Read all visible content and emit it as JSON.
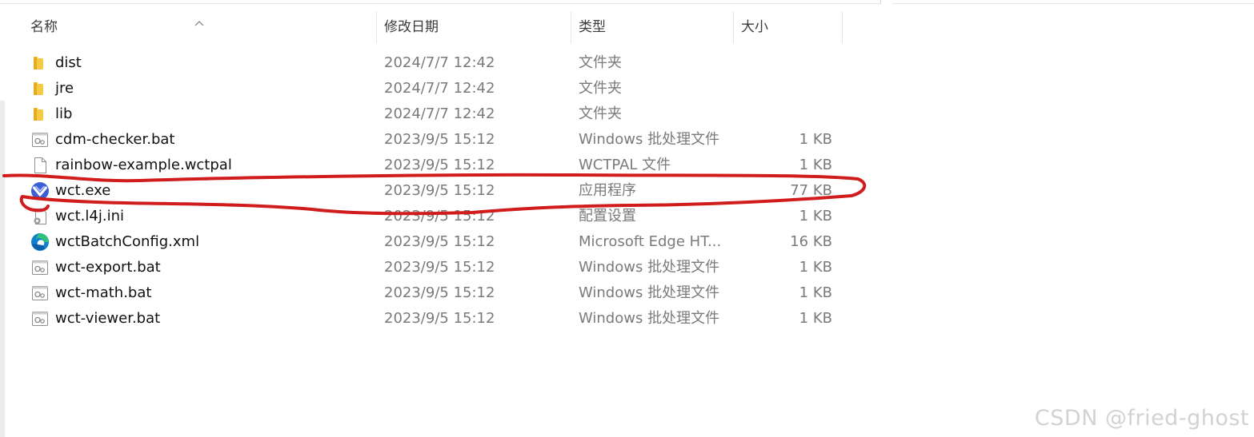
{
  "columns": {
    "name": "名称",
    "date": "修改日期",
    "type": "类型",
    "size": "大小"
  },
  "files": [
    {
      "icon": "folder-icon",
      "name": "dist",
      "date": "2024/7/7 12:42",
      "type": "文件夹",
      "size": ""
    },
    {
      "icon": "folder-icon",
      "name": "jre",
      "date": "2024/7/7 12:42",
      "type": "文件夹",
      "size": ""
    },
    {
      "icon": "folder-icon",
      "name": "lib",
      "date": "2024/7/7 12:42",
      "type": "文件夹",
      "size": ""
    },
    {
      "icon": "batch-file-icon",
      "name": "cdm-checker.bat",
      "date": "2023/9/5 15:12",
      "type": "Windows 批处理文件",
      "size": "1 KB"
    },
    {
      "icon": "blank-file-icon",
      "name": "rainbow-example.wctpal",
      "date": "2023/9/5 15:12",
      "type": "WCTPAL 文件",
      "size": "1 KB"
    },
    {
      "icon": "wct-app-icon",
      "name": "wct.exe",
      "date": "2023/9/5 15:12",
      "type": "应用程序",
      "size": "77 KB"
    },
    {
      "icon": "config-file-icon",
      "name": "wct.l4j.ini",
      "date": "2023/9/5 15:12",
      "type": "配置设置",
      "size": "1 KB"
    },
    {
      "icon": "edge-icon",
      "name": "wctBatchConfig.xml",
      "date": "2023/9/5 15:12",
      "type": "Microsoft Edge HT...",
      "size": "16 KB"
    },
    {
      "icon": "batch-file-icon",
      "name": "wct-export.bat",
      "date": "2023/9/5 15:12",
      "type": "Windows 批处理文件",
      "size": "1 KB"
    },
    {
      "icon": "batch-file-icon",
      "name": "wct-math.bat",
      "date": "2023/9/5 15:12",
      "type": "Windows 批处理文件",
      "size": "1 KB"
    },
    {
      "icon": "batch-file-icon",
      "name": "wct-viewer.bat",
      "date": "2023/9/5 15:12",
      "type": "Windows 批处理文件",
      "size": "1 KB"
    }
  ],
  "highlighted_row": 5,
  "annotation_color": "#d01c1c",
  "watermark": "CSDN @fried-ghost"
}
